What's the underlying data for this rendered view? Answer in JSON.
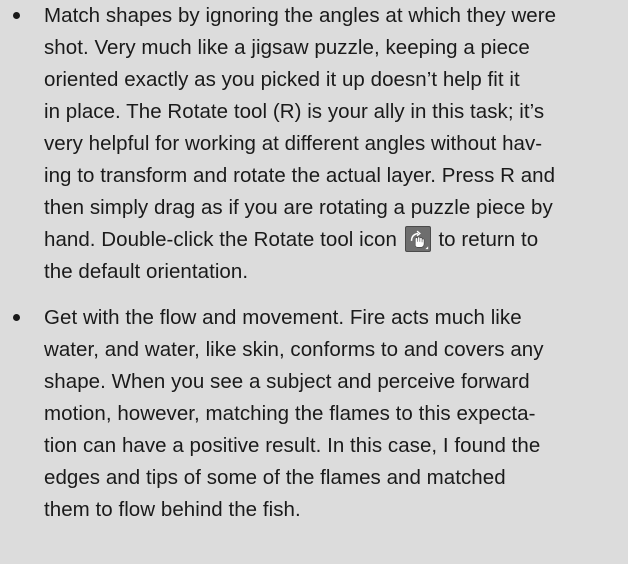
{
  "bullets": [
    {
      "lines": [
        "Match shapes by ignoring the angles at which they were",
        "shot. Very much like a jigsaw puzzle, keeping a piece",
        "oriented exactly as you picked it up doesn’t help fit it",
        "in place. The Rotate tool (R) is your ally in this task; it’s",
        "very helpful for working at different angles without hav-",
        "ing to transform and rotate the actual layer. Press R and",
        "then simply drag as if you are rotating a puzzle piece by"
      ],
      "icon_line_before": "hand. Double-click the Rotate tool icon",
      "icon_line_after": "to return to",
      "last_line": "the default orientation.",
      "icon": "rotate-view-tool-icon"
    },
    {
      "lines": [
        "Get with the flow and movement. Fire acts much like",
        "water, and water, like skin, conforms to and covers any",
        "shape. When you see a subject and perceive forward",
        "motion, however, matching the flames to this expecta-",
        "tion can have a positive result. In this case, I found the",
        "edges and tips of some of the flames and matched",
        "them to flow behind the fish."
      ]
    }
  ]
}
